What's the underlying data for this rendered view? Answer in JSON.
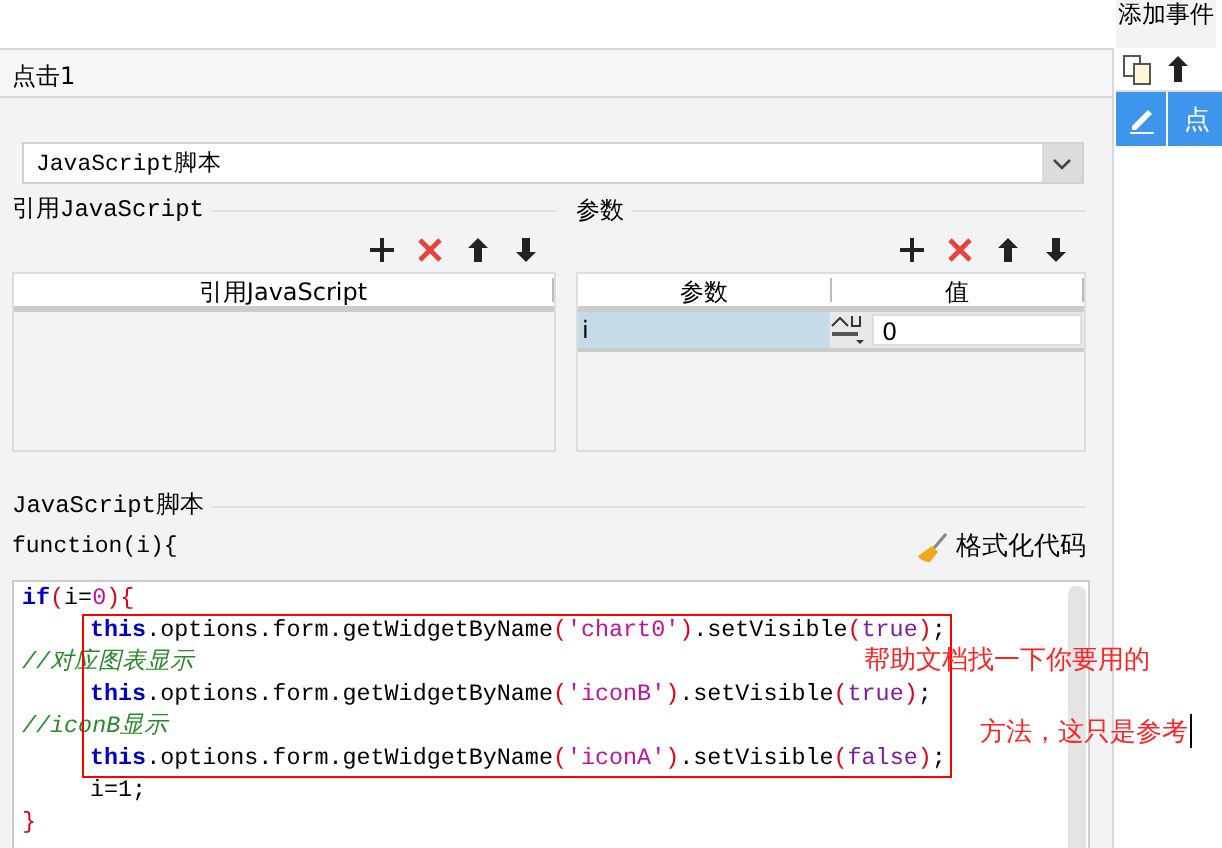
{
  "main_panel": {
    "title": "点击1",
    "action_type": "JavaScript脚本",
    "referenced_js": {
      "legend": "引用JavaScript",
      "columns": [
        "引用JavaScript"
      ]
    },
    "parameters": {
      "legend": "参数",
      "columns": [
        "参数",
        "值"
      ],
      "rows": [
        {
          "name": "i",
          "value": "0",
          "selected": true
        }
      ]
    },
    "script": {
      "legend": "JavaScript脚本",
      "signature": "function(i){",
      "format_button": "格式化代码",
      "blocks": [
        {
          "kind": "line",
          "indent": false,
          "tokens": [
            {
              "kind": "kw",
              "text": "if"
            },
            {
              "kind": "paren",
              "text": "("
            },
            {
              "kind": "plain",
              "text": "i="
            },
            {
              "kind": "num",
              "text": "0"
            },
            {
              "kind": "paren",
              "text": ")"
            },
            {
              "kind": "paren",
              "text": "{"
            }
          ]
        },
        {
          "kind": "boxed",
          "lines": [
            {
              "indent": true,
              "tokens": [
                {
                  "kind": "kw",
                  "text": "this"
                },
                {
                  "kind": "plain",
                  "text": ".options.form.getWidgetByName"
                },
                {
                  "kind": "paren",
                  "text": "("
                },
                {
                  "kind": "str",
                  "text": "'chart0'"
                },
                {
                  "kind": "paren",
                  "text": ")"
                },
                {
                  "kind": "plain",
                  "text": ".setVisible"
                },
                {
                  "kind": "paren",
                  "text": "("
                },
                {
                  "kind": "bool",
                  "text": "true"
                },
                {
                  "kind": "paren",
                  "text": ")"
                },
                {
                  "kind": "plain",
                  "text": ";"
                }
              ]
            },
            {
              "indent": false,
              "tokens": [
                {
                  "kind": "comment",
                  "text": "//对应图表显示"
                }
              ]
            },
            {
              "indent": true,
              "tokens": [
                {
                  "kind": "kw",
                  "text": "this"
                },
                {
                  "kind": "plain",
                  "text": ".options.form.getWidgetByName"
                },
                {
                  "kind": "paren",
                  "text": "("
                },
                {
                  "kind": "str",
                  "text": "'iconB'"
                },
                {
                  "kind": "paren",
                  "text": ")"
                },
                {
                  "kind": "plain",
                  "text": ".setVisible"
                },
                {
                  "kind": "paren",
                  "text": "("
                },
                {
                  "kind": "bool",
                  "text": "true"
                },
                {
                  "kind": "paren",
                  "text": ")"
                },
                {
                  "kind": "plain",
                  "text": ";"
                }
              ]
            },
            {
              "indent": false,
              "tokens": [
                {
                  "kind": "comment",
                  "text": "//iconB显示"
                }
              ]
            },
            {
              "indent": true,
              "tokens": [
                {
                  "kind": "kw",
                  "text": "this"
                },
                {
                  "kind": "plain",
                  "text": ".options.form.getWidgetByName"
                },
                {
                  "kind": "paren",
                  "text": "("
                },
                {
                  "kind": "str",
                  "text": "'iconA'"
                },
                {
                  "kind": "paren",
                  "text": ")"
                },
                {
                  "kind": "plain",
                  "text": ".setVisible"
                },
                {
                  "kind": "paren",
                  "text": "("
                },
                {
                  "kind": "bool",
                  "text": "false"
                },
                {
                  "kind": "paren",
                  "text": ")"
                },
                {
                  "kind": "plain",
                  "text": ";"
                }
              ]
            }
          ]
        },
        {
          "kind": "line",
          "indent": true,
          "tokens": [
            {
              "kind": "plain",
              "text": "i=1;"
            }
          ]
        },
        {
          "kind": "line",
          "indent": false,
          "tokens": [
            {
              "kind": "paren",
              "text": "}"
            }
          ]
        }
      ]
    }
  },
  "annotation": [
    "帮助文档找一下你要用的",
    "方法，这只是参考"
  ],
  "event_panel": {
    "title": "添加事件",
    "items": [
      {
        "label": "点",
        "selected": true
      }
    ]
  }
}
